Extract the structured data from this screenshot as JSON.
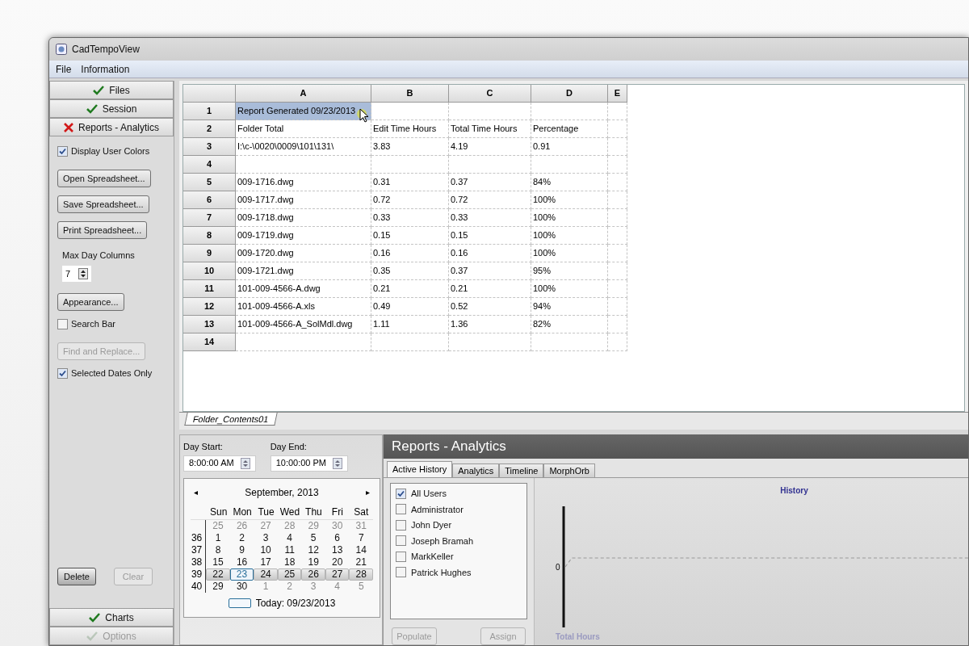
{
  "window": {
    "title": "CadTempoView"
  },
  "menu": [
    "File",
    "Information"
  ],
  "sidebar": {
    "nav_top": [
      {
        "label": "Files",
        "kind": "check"
      },
      {
        "label": "Session",
        "kind": "check"
      },
      {
        "label": "Reports - Analytics",
        "kind": "cross"
      }
    ],
    "controls": [
      {
        "kind": "checkbox",
        "label": "Display User Colors",
        "checked": true
      },
      {
        "kind": "button",
        "label": "Open Spreadsheet...",
        "disabled": false
      },
      {
        "kind": "button",
        "label": "Save Spreadsheet...",
        "disabled": false
      },
      {
        "kind": "button",
        "label": "Print Spreadsheet...",
        "disabled": false
      },
      {
        "kind": "spinner",
        "label": "Max Day Columns",
        "value": "7"
      },
      {
        "kind": "button",
        "label": "Appearance...",
        "disabled": false
      },
      {
        "kind": "checkbox",
        "label": "Search Bar",
        "checked": false
      },
      {
        "kind": "button",
        "label": "Find and Replace...",
        "disabled": true
      },
      {
        "kind": "checkbox",
        "label": "Selected Dates Only",
        "checked": true
      }
    ],
    "bottom_buttons": [
      {
        "label": "Delete",
        "disabled": false
      },
      {
        "label": "Clear",
        "disabled": true
      }
    ],
    "nav_bottom": [
      {
        "label": "Charts",
        "kind": "check",
        "faded": false
      },
      {
        "label": "Options",
        "kind": "check",
        "faded": true
      }
    ]
  },
  "sheet": {
    "columns": [
      "A",
      "B",
      "C",
      "D",
      "E"
    ],
    "rows": [
      {
        "number": "1",
        "selected": true,
        "cells": {
          "a": "Report Generated 09/23/2013"
        }
      },
      {
        "number": "2",
        "selected": false,
        "cells": {
          "a": "Folder Total",
          "b": "Edit Time Hours",
          "c": "Total Time Hours",
          "d": "Percentage"
        }
      },
      {
        "number": "3",
        "selected": false,
        "cells": {
          "a": "I:\\c-\\0020\\0009\\101\\131\\",
          "b": "3.83",
          "c": "4.19",
          "d": "0.91"
        }
      },
      {
        "number": "4",
        "selected": false,
        "cells": {}
      },
      {
        "number": "5",
        "selected": false,
        "cells": {
          "a": "009-1716.dwg",
          "b": "0.31",
          "c": "0.37",
          "d": "84%"
        }
      },
      {
        "number": "6",
        "selected": false,
        "cells": {
          "a": "009-1717.dwg",
          "b": "0.72",
          "c": "0.72",
          "d": "100%"
        }
      },
      {
        "number": "7",
        "selected": false,
        "cells": {
          "a": "009-1718.dwg",
          "b": "0.33",
          "c": "0.33",
          "d": "100%"
        }
      },
      {
        "number": "8",
        "selected": false,
        "cells": {
          "a": "009-1719.dwg",
          "b": "0.15",
          "c": "0.15",
          "d": "100%"
        }
      },
      {
        "number": "9",
        "selected": false,
        "cells": {
          "a": "009-1720.dwg",
          "b": "0.16",
          "c": "0.16",
          "d": "100%"
        }
      },
      {
        "number": "10",
        "selected": false,
        "cells": {
          "a": "009-1721.dwg",
          "b": "0.35",
          "c": "0.37",
          "d": "95%"
        }
      },
      {
        "number": "11",
        "selected": false,
        "cells": {
          "a": "101-009-4566-A.dwg",
          "b": "0.21",
          "c": "0.21",
          "d": "100%"
        }
      },
      {
        "number": "12",
        "selected": false,
        "cells": {
          "a": "101-009-4566-A.xls",
          "b": "0.49",
          "c": "0.52",
          "d": "94%"
        }
      },
      {
        "number": "13",
        "selected": false,
        "cells": {
          "a": "101-009-4566-A_SolMdl.dwg",
          "b": "1.11",
          "c": "1.36",
          "d": "82%"
        }
      },
      {
        "number": "14",
        "selected": false,
        "cells": {}
      }
    ],
    "tabs": [
      {
        "label": "Folder_Contents01",
        "selected": true
      }
    ]
  },
  "times": [
    {
      "label": "Day Start:",
      "value": "8:00:00 AM"
    },
    {
      "label": "Day End:",
      "value": "10:00:00 PM"
    }
  ],
  "calendar": {
    "prev": "◂",
    "next": "▸",
    "month": "September, 2013",
    "weekdays": [
      "Sun",
      "Mon",
      "Tue",
      "Wed",
      "Thu",
      "Fri",
      "Sat"
    ],
    "weeks": [
      {
        "days": [
          {
            "label": "25",
            "other": true,
            "selected": false,
            "today": false
          },
          {
            "label": "26",
            "other": true,
            "selected": false,
            "today": false
          },
          {
            "label": "27",
            "other": true,
            "selected": false,
            "today": false
          },
          {
            "label": "28",
            "other": true,
            "selected": false,
            "today": false
          },
          {
            "label": "29",
            "other": true,
            "selected": false,
            "today": false
          },
          {
            "label": "30",
            "other": true,
            "selected": false,
            "today": false
          },
          {
            "label": "31",
            "other": true,
            "selected": false,
            "today": false
          }
        ]
      },
      {
        "number": "36",
        "days": [
          {
            "label": "1",
            "other": false,
            "selected": false,
            "today": false
          },
          {
            "label": "2",
            "other": false,
            "selected": false,
            "today": false
          },
          {
            "label": "3",
            "other": false,
            "selected": false,
            "today": false
          },
          {
            "label": "4",
            "other": false,
            "selected": false,
            "today": false
          },
          {
            "label": "5",
            "other": false,
            "selected": false,
            "today": false
          },
          {
            "label": "6",
            "other": false,
            "selected": false,
            "today": false
          },
          {
            "label": "7",
            "other": false,
            "selected": false,
            "today": false
          }
        ]
      },
      {
        "number": "37",
        "days": [
          {
            "label": "8",
            "other": false,
            "selected": false,
            "today": false
          },
          {
            "label": "9",
            "other": false,
            "selected": false,
            "today": false
          },
          {
            "label": "10",
            "other": false,
            "selected": false,
            "today": false
          },
          {
            "label": "11",
            "other": false,
            "selected": false,
            "today": false
          },
          {
            "label": "12",
            "other": false,
            "selected": false,
            "today": false
          },
          {
            "label": "13",
            "other": false,
            "selected": false,
            "today": false
          },
          {
            "label": "14",
            "other": false,
            "selected": false,
            "today": false
          }
        ]
      },
      {
        "number": "38",
        "days": [
          {
            "label": "15",
            "other": false,
            "selected": false,
            "today": false
          },
          {
            "label": "16",
            "other": false,
            "selected": false,
            "today": false
          },
          {
            "label": "17",
            "other": false,
            "selected": false,
            "today": false
          },
          {
            "label": "18",
            "other": false,
            "selected": false,
            "today": false
          },
          {
            "label": "19",
            "other": false,
            "selected": false,
            "today": false
          },
          {
            "label": "20",
            "other": false,
            "selected": false,
            "today": false
          },
          {
            "label": "21",
            "other": false,
            "selected": false,
            "today": false
          }
        ]
      },
      {
        "number": "39",
        "days": [
          {
            "label": "22",
            "other": false,
            "selected": true,
            "today": false
          },
          {
            "label": "23",
            "other": false,
            "selected": true,
            "today": true
          },
          {
            "label": "24",
            "other": false,
            "selected": true,
            "today": false
          },
          {
            "label": "25",
            "other": false,
            "selected": true,
            "today": false
          },
          {
            "label": "26",
            "other": false,
            "selected": true,
            "today": false
          },
          {
            "label": "27",
            "other": false,
            "selected": true,
            "today": false
          },
          {
            "label": "28",
            "other": false,
            "selected": true,
            "today": false
          }
        ]
      },
      {
        "number": "40",
        "days": [
          {
            "label": "29",
            "other": false,
            "selected": false,
            "today": false
          },
          {
            "label": "30",
            "other": false,
            "selected": false,
            "today": false
          },
          {
            "label": "1",
            "other": true,
            "selected": false,
            "today": false
          },
          {
            "label": "2",
            "other": true,
            "selected": false,
            "today": false
          },
          {
            "label": "3",
            "other": true,
            "selected": false,
            "today": false
          },
          {
            "label": "4",
            "other": true,
            "selected": false,
            "today": false
          },
          {
            "label": "5",
            "other": true,
            "selected": false,
            "today": false
          }
        ]
      }
    ],
    "today": "Today: 09/23/2013"
  },
  "reports": {
    "title": "Reports - Analytics",
    "tabs": [
      {
        "label": "Active History",
        "selected": true
      },
      {
        "label": "Analytics",
        "selected": false
      },
      {
        "label": "Timeline",
        "selected": false
      },
      {
        "label": "MorphOrb",
        "selected": false
      }
    ],
    "users": [
      {
        "label": "All Users",
        "checked": true
      },
      {
        "label": "Administrator",
        "checked": false
      },
      {
        "label": "John Dyer",
        "checked": false
      },
      {
        "label": "Joseph Bramah",
        "checked": false
      },
      {
        "label": "MarkKeller",
        "checked": false
      },
      {
        "label": "Patrick Hughes",
        "checked": false
      }
    ],
    "buttons": [
      {
        "label": "Populate",
        "disabled": true
      },
      {
        "label": "Assign",
        "disabled": true
      }
    ],
    "chart": {
      "title": "History",
      "tick": "0",
      "axis_label": "Total Hours"
    }
  }
}
